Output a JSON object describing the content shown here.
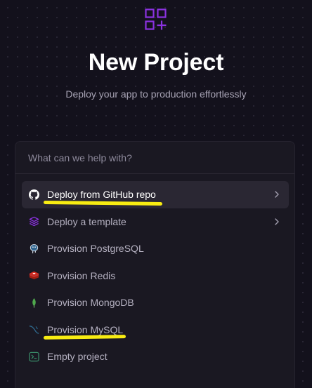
{
  "page": {
    "title": "New Project",
    "subtitle": "Deploy your app to production effortlessly"
  },
  "search": {
    "placeholder": "What can we help with?"
  },
  "menu": {
    "items": [
      {
        "label": "Deploy from GitHub repo",
        "icon": "github-icon",
        "has_chevron": true,
        "active": true
      },
      {
        "label": "Deploy a template",
        "icon": "layers-icon",
        "has_chevron": true,
        "active": false
      },
      {
        "label": "Provision PostgreSQL",
        "icon": "postgresql-icon",
        "has_chevron": false,
        "active": false
      },
      {
        "label": "Provision Redis",
        "icon": "redis-icon",
        "has_chevron": false,
        "active": false
      },
      {
        "label": "Provision MongoDB",
        "icon": "mongodb-icon",
        "has_chevron": false,
        "active": false
      },
      {
        "label": "Provision MySQL",
        "icon": "mysql-icon",
        "has_chevron": false,
        "active": false
      },
      {
        "label": "Empty project",
        "icon": "terminal-icon",
        "has_chevron": false,
        "active": false
      }
    ]
  },
  "colors": {
    "background": "#13111c",
    "panel": "#1a1822",
    "accent_purple": "#8b32e0",
    "highlight_marker": "#f8ec12"
  }
}
